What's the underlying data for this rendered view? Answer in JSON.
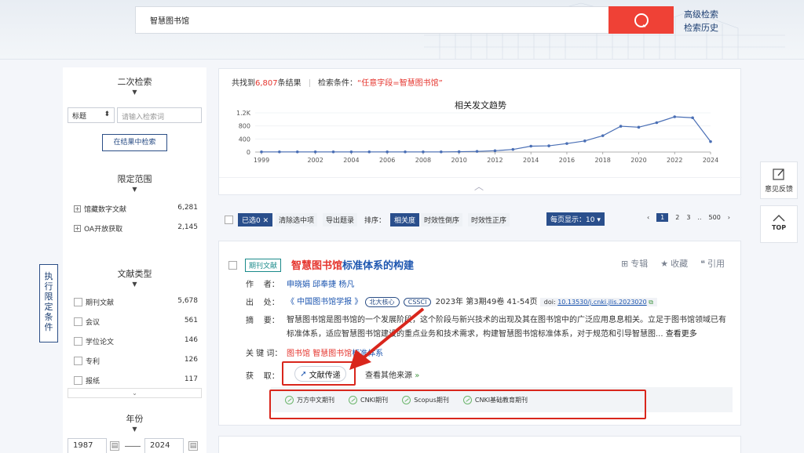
{
  "search": {
    "query": "智慧图书馆",
    "advanced_label": "高级检索",
    "history_label": "检索历史"
  },
  "sidebar": {
    "secondary_title": "二次检索",
    "field_select": "标题",
    "search_placeholder": "请输入检索词",
    "search_in_results": "在结果中检索",
    "scope_title": "限定范围",
    "scope_items": [
      {
        "label": "馆藏数字文献",
        "count": "6,281"
      },
      {
        "label": "OA开放获取",
        "count": "2,145"
      }
    ],
    "doctype_title": "文献类型",
    "doctype_items": [
      {
        "label": "期刊文献",
        "count": "5,678"
      },
      {
        "label": "会议",
        "count": "561"
      },
      {
        "label": "学位论文",
        "count": "146"
      },
      {
        "label": "专利",
        "count": "126"
      },
      {
        "label": "报纸",
        "count": "117"
      }
    ],
    "year_title": "年份",
    "year_from": "1987",
    "year_to": "2024",
    "execute_label": "执行限定条件"
  },
  "summary": {
    "prefix": "共找到",
    "count": "6,807",
    "suffix": "条结果",
    "condition_label": "检索条件：",
    "condition_value": "“任意字段=智慧图书馆”"
  },
  "chart_data": {
    "type": "line",
    "title": "相关发文趋势",
    "x": [
      1999,
      2000,
      2001,
      2002,
      2003,
      2004,
      2005,
      2006,
      2007,
      2008,
      2009,
      2010,
      2011,
      2012,
      2013,
      2014,
      2015,
      2016,
      2017,
      2018,
      2019,
      2020,
      2021,
      2022,
      2023,
      2024
    ],
    "y": [
      5,
      5,
      5,
      5,
      5,
      5,
      5,
      5,
      5,
      5,
      5,
      10,
      20,
      40,
      80,
      180,
      190,
      260,
      340,
      500,
      790,
      760,
      900,
      1080,
      1050,
      320
    ],
    "xticks": [
      "1999",
      "2002",
      "2004",
      "2006",
      "2008",
      "2010",
      "2012",
      "2014",
      "2016",
      "2018",
      "2020",
      "2022",
      "2024"
    ],
    "yticks": [
      "0",
      "400",
      "800",
      "1.2K"
    ],
    "ylim": [
      0,
      1200
    ],
    "color": "#4a6fb5"
  },
  "toolbar": {
    "selected": "已选0",
    "clear": "清除选中项",
    "export": "导出题录",
    "sort_label": "排序：",
    "sort_relevance": "相关度",
    "sort_desc": "时效性倒序",
    "sort_asc": "时效性正序",
    "per_page": "每页显示：10",
    "pages": [
      "1",
      "2",
      "3",
      "..",
      "500"
    ]
  },
  "result": {
    "type": "期刊文献",
    "title_hl": "智慧图书馆",
    "title_rest": "标准体系的构建",
    "actions": {
      "zhuanji": "专辑",
      "collect": "收藏",
      "cite": "引用"
    },
    "author_label": "作    者：",
    "authors": "申晓娟 邱奉捷 杨凡",
    "source_label": "出    处：",
    "journal": "《 中国图书馆学报 》",
    "badge1": "北大核心",
    "badge2": "CSSCI",
    "issue": "2023年 第3期49卷 41-54页",
    "doi_label": "doi:",
    "doi": "10.13530/j.cnki.jlis.2023020",
    "abstract_label": "摘    要：",
    "abstract_line1": "智慧图书馆是图书馆的一个发展阶段，这个阶段与新兴技术的出现及其在图书馆中的广泛应用息息相关。立足于图书馆领域已有",
    "abstract_line2": "标准体系，适应智慧图书馆建设的重点业务和技术需求，构建智慧图书馆标准体系，对于规范和引导智慧图...",
    "more": "查看更多",
    "keywords_label": "关 键 词：",
    "keywords": [
      "图书馆",
      "智慧图书馆",
      "标准体系"
    ],
    "get_label": "获    取：",
    "delivery": "文献传递",
    "other_sources": "查看其他来源",
    "sources": [
      "万方中文期刊",
      "CNKI期刊",
      "Scopus期刊",
      "CNKI基础教育期刊"
    ]
  },
  "float": {
    "feedback": "意见反馈",
    "top": "TOP"
  }
}
